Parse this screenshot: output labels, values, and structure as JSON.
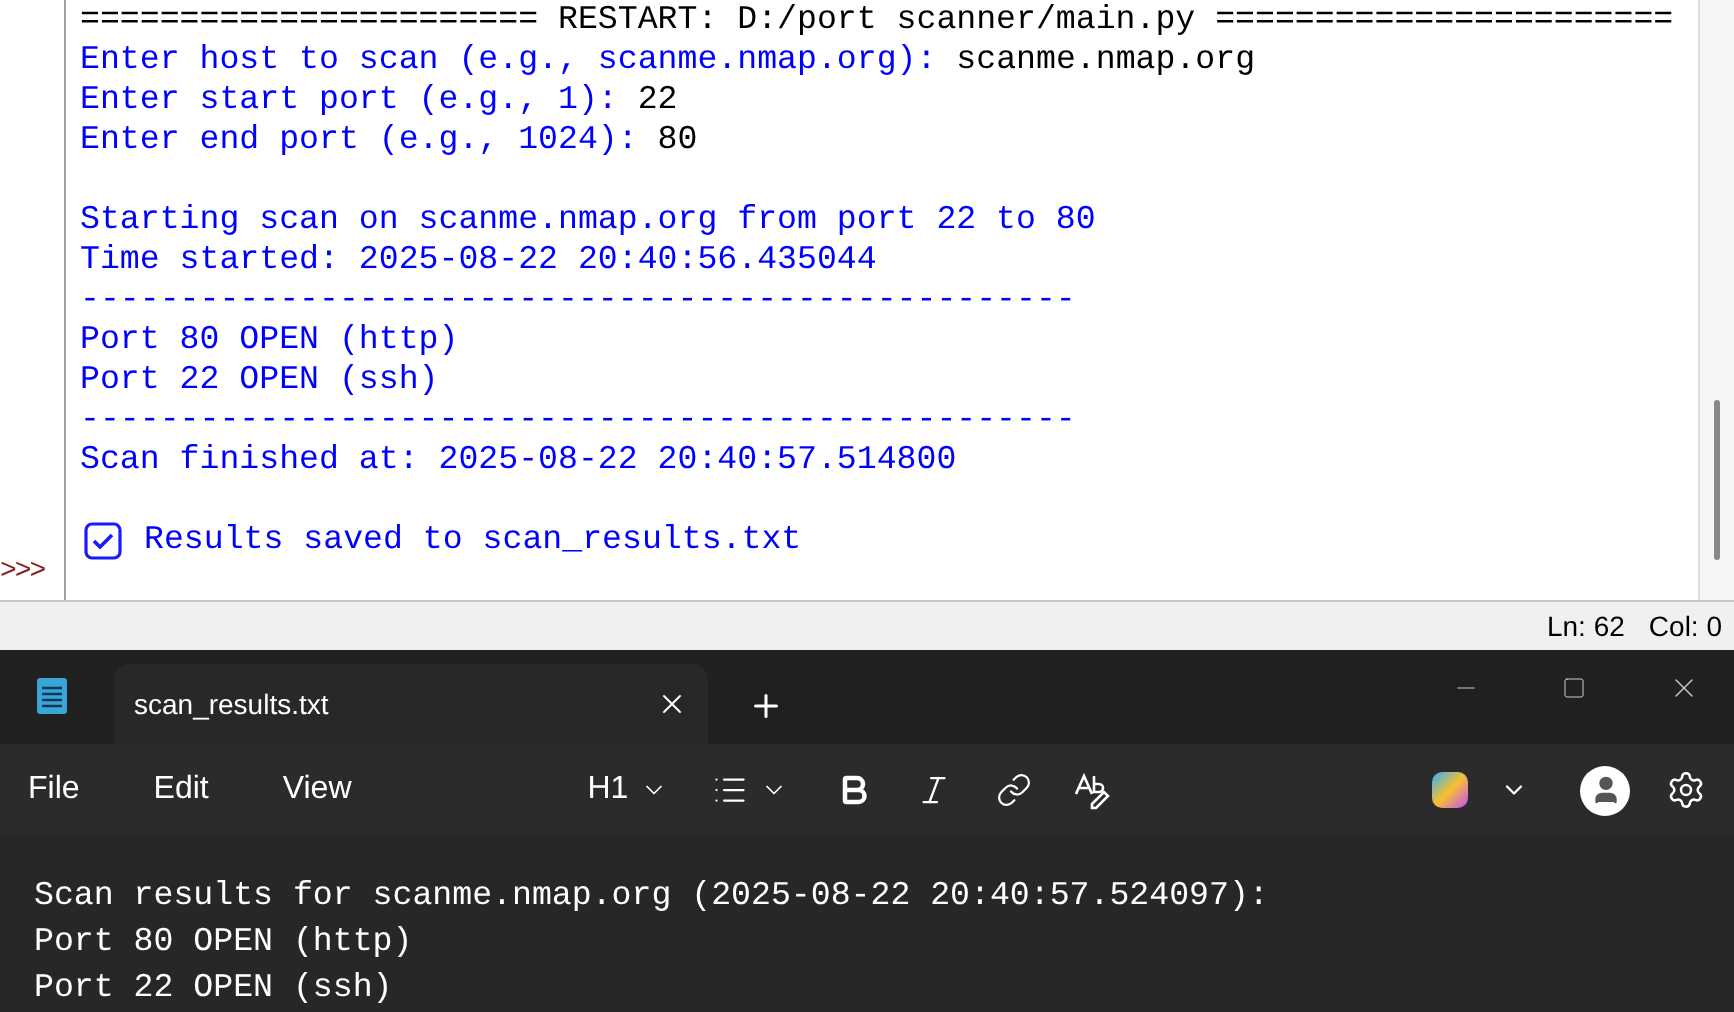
{
  "shell": {
    "prompt": ">>>",
    "lines": [
      {
        "kind": "restart",
        "text": "======================= RESTART: D:/port scanner/main.py ======================="
      },
      {
        "kind": "output",
        "text": "Enter host to scan (e.g., scanme.nmap.org): ",
        "input": "scanme.nmap.org"
      },
      {
        "kind": "output",
        "text": "Enter start port (e.g., 1): ",
        "input": "22"
      },
      {
        "kind": "output",
        "text": "Enter end port (e.g., 1024): ",
        "input": "80"
      },
      {
        "kind": "blank"
      },
      {
        "kind": "output",
        "text": "Starting scan on scanme.nmap.org from port 22 to 80"
      },
      {
        "kind": "output",
        "text": "Time started: 2025-08-22 20:40:56.435044"
      },
      {
        "kind": "output",
        "text": "--------------------------------------------------"
      },
      {
        "kind": "output",
        "text": "Port 80 OPEN (http)"
      },
      {
        "kind": "output",
        "text": "Port 22 OPEN (ssh)"
      },
      {
        "kind": "output",
        "text": "--------------------------------------------------"
      },
      {
        "kind": "output",
        "text": "Scan finished at: 2025-08-22 20:40:57.514800"
      },
      {
        "kind": "blank"
      },
      {
        "kind": "check",
        "text": "Results saved to scan_results.txt"
      }
    ]
  },
  "status_bar": {
    "line": "Ln: 62",
    "column": "Col: 0"
  },
  "notepad": {
    "tabs": [
      {
        "label": "scan_results.txt",
        "selected": true
      }
    ],
    "menu": [
      "File",
      "Edit",
      "View"
    ],
    "heading_button": "H1",
    "content": [
      "Scan results for scanme.nmap.org (2025-08-22 20:40:57.524097):",
      "Port 80 OPEN (http)",
      "Port 22 OPEN (ssh)"
    ]
  }
}
